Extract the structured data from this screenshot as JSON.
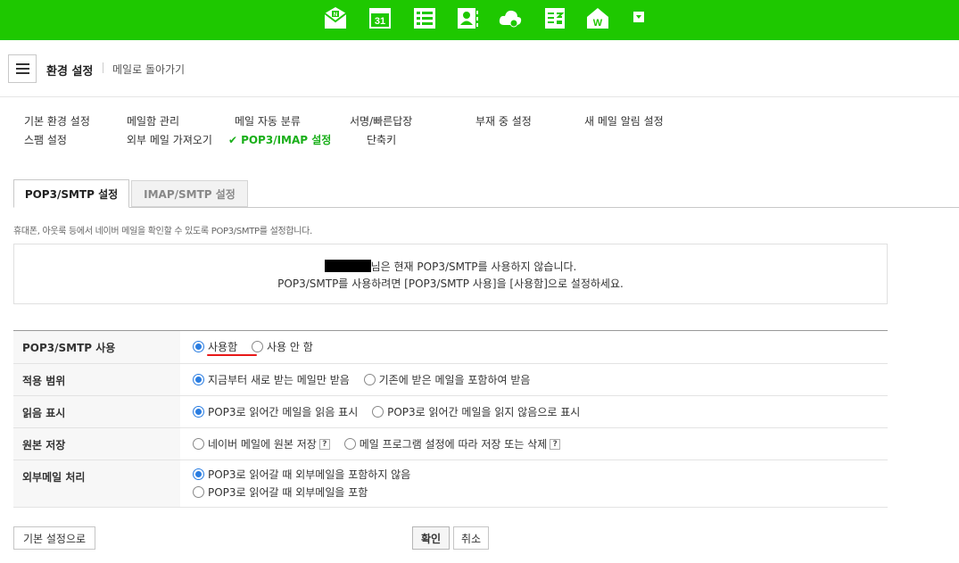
{
  "header": {
    "title": "환경 설정",
    "back_link": "메일로 돌아가기"
  },
  "topbar_icons": [
    "mail-icon",
    "calendar-icon",
    "contacts-list-icon",
    "address-book-icon",
    "cloud-icon",
    "memo-icon",
    "home-icon",
    "dropdown-icon"
  ],
  "calendar_day": "31",
  "nav": {
    "basic": "기본 환경 설정",
    "mailbox": "메일함 관리",
    "auto_sort": "메일 자동 분류",
    "signature": "서명/빠른답장",
    "away": "부재 중 설정",
    "new_mail_alert": "새 메일 알림 설정",
    "spam": "스팸 설정",
    "external": "외부 메일 가져오기",
    "pop3": "POP3/IMAP 설정",
    "shortcut": "단축키"
  },
  "tabs": {
    "pop3": "POP3/SMTP 설정",
    "imap": "IMAP/SMTP 설정"
  },
  "description": "휴대폰, 아웃룩 등에서 네이버 메일을 확인할 수 있도록 POP3/SMTP를 설정합니다.",
  "notice": {
    "line1_suffix": "님은 현재 POP3/SMTP를 사용하지 않습니다.",
    "line2": "POP3/SMTP를 사용하려면 [POP3/SMTP 사용]을 [사용함]으로 설정하세요."
  },
  "settings": {
    "use": {
      "label": "POP3/SMTP 사용",
      "opt1": "사용함",
      "opt2": "사용 안 함"
    },
    "scope": {
      "label": "적용 범위",
      "opt1": "지금부터 새로 받는 메일만 받음",
      "opt2": "기존에 받은 메일을 포함하여 받음"
    },
    "read": {
      "label": "읽음 표시",
      "opt1": "POP3로 읽어간 메일을 읽음 표시",
      "opt2": "POP3로 읽어간 메일을 읽지 않음으로 표시"
    },
    "keep": {
      "label": "원본 저장",
      "opt1": "네이버 메일에 원본 저장",
      "opt2": "메일 프로그램 설정에 따라 저장 또는 삭제"
    },
    "external": {
      "label": "외부메일 처리",
      "opt1": "POP3로 읽어갈 때 외부메일을 포함하지 않음",
      "opt2": "POP3로 읽어갈 때 외부메일을 포함"
    }
  },
  "help_glyph": "?",
  "buttons": {
    "reset": "기본 설정으로",
    "confirm": "확인",
    "cancel": "취소"
  },
  "colors": {
    "brand_green": "#1ec800",
    "active_nav": "#1aaf1a",
    "radio_blue": "#2a7de1",
    "highlight_red": "#e81818"
  }
}
